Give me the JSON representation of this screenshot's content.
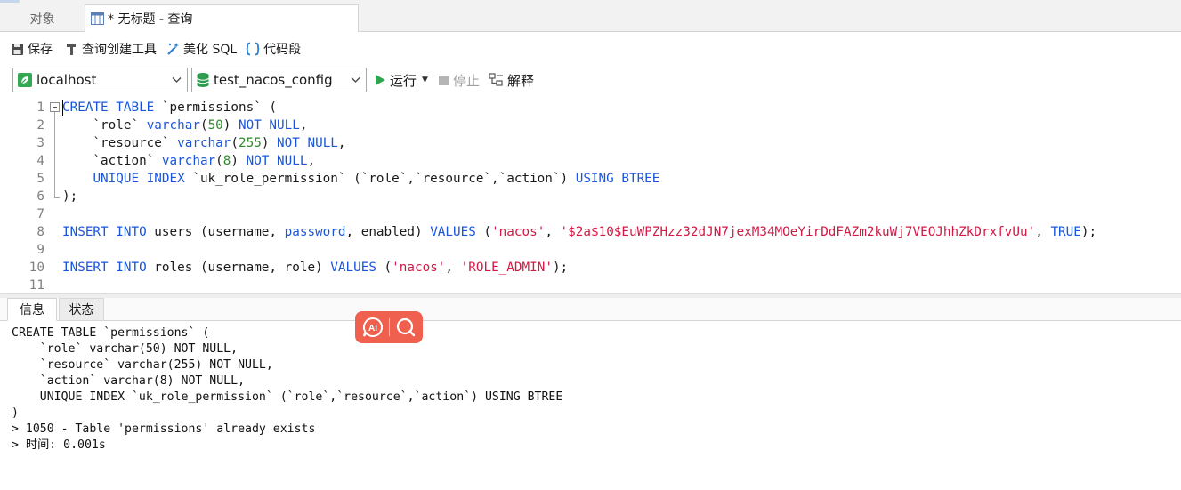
{
  "tabs": {
    "objects": "对象",
    "query": "* 无标题 - 查询"
  },
  "toolbar": {
    "save": "保存",
    "query_builder": "查询创建工具",
    "beautify_sql": "美化 SQL",
    "code_snippet": "代码段"
  },
  "toolbar2": {
    "connection": "localhost",
    "database": "test_nacos_config",
    "run": "运行",
    "stop": "停止",
    "explain": "解释"
  },
  "editor": {
    "lines": [
      {
        "n": "1",
        "tokens": [
          {
            "t": "CREATE TABLE",
            "k": "kw"
          },
          {
            "t": " `permissions` (",
            "k": "plain"
          }
        ]
      },
      {
        "n": "2",
        "tokens": [
          {
            "t": "    `role` ",
            "k": "plain"
          },
          {
            "t": "varchar",
            "k": "kw"
          },
          {
            "t": "(",
            "k": "plain"
          },
          {
            "t": "50",
            "k": "num"
          },
          {
            "t": ") ",
            "k": "plain"
          },
          {
            "t": "NOT NULL",
            "k": "kw"
          },
          {
            "t": ",",
            "k": "plain"
          }
        ]
      },
      {
        "n": "3",
        "tokens": [
          {
            "t": "    `resource` ",
            "k": "plain"
          },
          {
            "t": "varchar",
            "k": "kw"
          },
          {
            "t": "(",
            "k": "plain"
          },
          {
            "t": "255",
            "k": "num"
          },
          {
            "t": ") ",
            "k": "plain"
          },
          {
            "t": "NOT NULL",
            "k": "kw"
          },
          {
            "t": ",",
            "k": "plain"
          }
        ]
      },
      {
        "n": "4",
        "tokens": [
          {
            "t": "    `action` ",
            "k": "plain"
          },
          {
            "t": "varchar",
            "k": "kw"
          },
          {
            "t": "(",
            "k": "plain"
          },
          {
            "t": "8",
            "k": "num"
          },
          {
            "t": ") ",
            "k": "plain"
          },
          {
            "t": "NOT NULL",
            "k": "kw"
          },
          {
            "t": ",",
            "k": "plain"
          }
        ]
      },
      {
        "n": "5",
        "tokens": [
          {
            "t": "    ",
            "k": "plain"
          },
          {
            "t": "UNIQUE INDEX",
            "k": "kw"
          },
          {
            "t": " `uk_role_permission` (`role`,`resource`,`action`) ",
            "k": "plain"
          },
          {
            "t": "USING BTREE",
            "k": "kw"
          }
        ]
      },
      {
        "n": "6",
        "tokens": [
          {
            "t": ");",
            "k": "plain"
          }
        ]
      },
      {
        "n": "7",
        "tokens": []
      },
      {
        "n": "8",
        "tokens": [
          {
            "t": "INSERT INTO",
            "k": "kw"
          },
          {
            "t": " users (username, ",
            "k": "plain"
          },
          {
            "t": "password",
            "k": "kw"
          },
          {
            "t": ", enabled) ",
            "k": "plain"
          },
          {
            "t": "VALUES",
            "k": "kw"
          },
          {
            "t": " (",
            "k": "plain"
          },
          {
            "t": "'nacos'",
            "k": "str"
          },
          {
            "t": ", ",
            "k": "plain"
          },
          {
            "t": "'$2a$10$EuWPZHzz32dJN7jexM34MOeYirDdFAZm2kuWj7VEOJhhZkDrxfvUu'",
            "k": "str"
          },
          {
            "t": ", ",
            "k": "plain"
          },
          {
            "t": "TRUE",
            "k": "kw"
          },
          {
            "t": ");",
            "k": "plain"
          }
        ]
      },
      {
        "n": "9",
        "tokens": []
      },
      {
        "n": "10",
        "tokens": [
          {
            "t": "INSERT INTO",
            "k": "kw"
          },
          {
            "t": " roles (username, role) ",
            "k": "plain"
          },
          {
            "t": "VALUES",
            "k": "kw"
          },
          {
            "t": " (",
            "k": "plain"
          },
          {
            "t": "'nacos'",
            "k": "str"
          },
          {
            "t": ", ",
            "k": "plain"
          },
          {
            "t": "'ROLE_ADMIN'",
            "k": "str"
          },
          {
            "t": ");",
            "k": "plain"
          }
        ]
      },
      {
        "n": "11",
        "tokens": []
      }
    ]
  },
  "result": {
    "tab_info": "信息",
    "tab_status": "状态",
    "lines": [
      "CREATE TABLE `permissions` (",
      "    `role` varchar(50) NOT NULL,",
      "    `resource` varchar(255) NOT NULL,",
      "    `action` varchar(8) NOT NULL,",
      "    UNIQUE INDEX `uk_role_permission` (`role`,`resource`,`action`) USING BTREE",
      ")",
      "> 1050 - Table 'permissions' already exists",
      "> 时间: 0.001s"
    ]
  },
  "icons": {
    "save": "save-icon",
    "query_builder": "hammer-icon",
    "beautify": "magic-wand-icon",
    "snippet": "braces-icon",
    "connection": "leaf-icon",
    "database": "database-icon",
    "run": "play-icon",
    "stop": "stop-icon",
    "explain": "explain-icon",
    "ai": "ai-icon",
    "search": "search-icon"
  },
  "colors": {
    "keyword": "#1a56db",
    "number": "#2e8b2e",
    "string": "#d11a44",
    "run": "#2ea44f",
    "ai_widget": "#f0604f",
    "connection_icon": "#34a853"
  }
}
